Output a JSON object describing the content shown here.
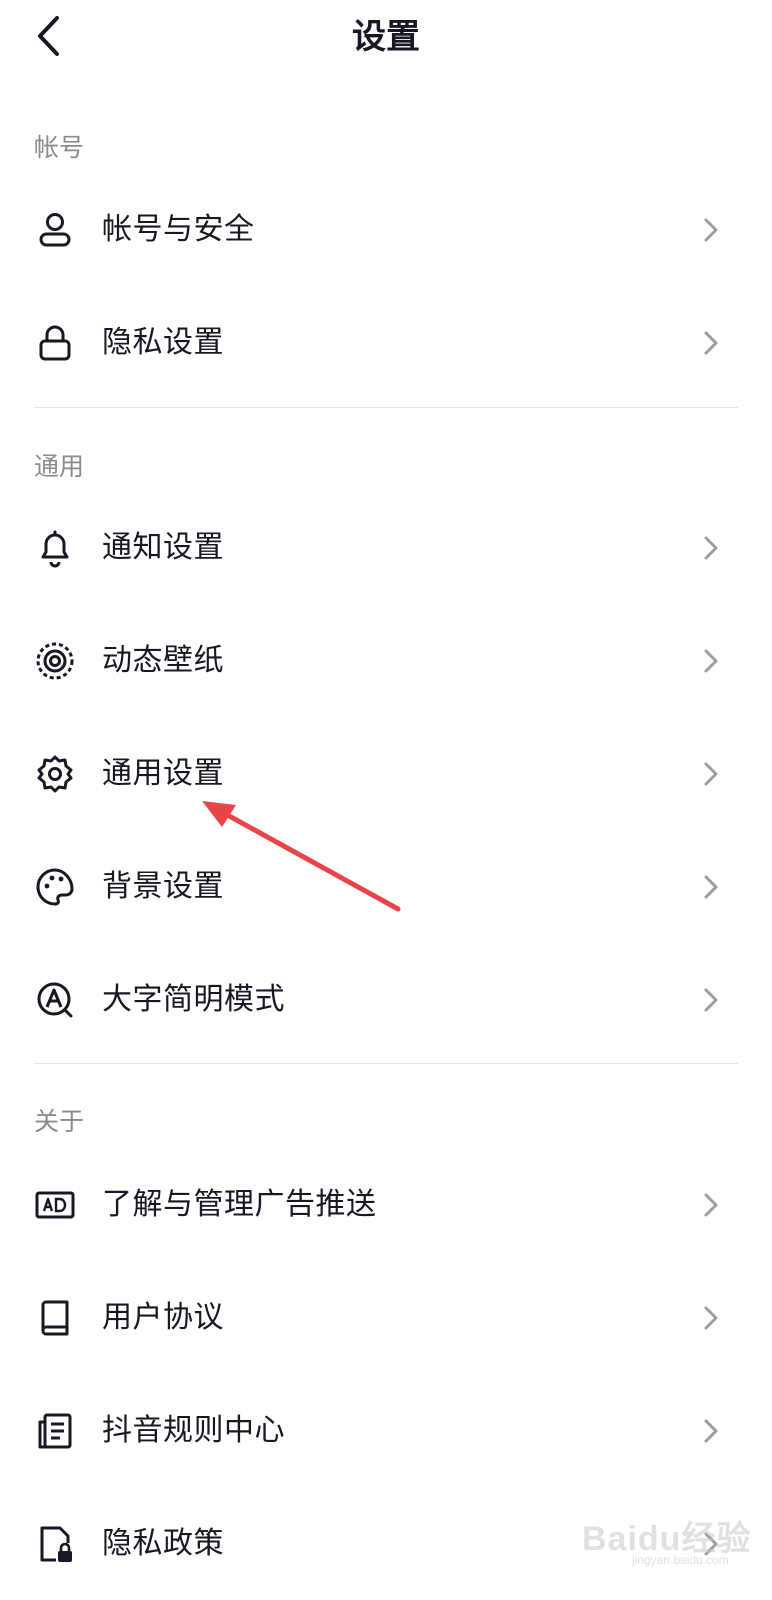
{
  "header": {
    "title": "设置"
  },
  "sections": [
    {
      "title": "帐号"
    },
    {
      "title": "通用"
    },
    {
      "title": "关于"
    }
  ],
  "rows": [
    {
      "label": "帐号与安全",
      "icon": "user-icon"
    },
    {
      "label": "隐私设置",
      "icon": "lock-icon"
    },
    {
      "label": "通知设置",
      "icon": "bell-icon"
    },
    {
      "label": "动态壁纸",
      "icon": "dynamic-wallpaper-icon"
    },
    {
      "label": "通用设置",
      "icon": "gear-icon"
    },
    {
      "label": "背景设置",
      "icon": "palette-icon"
    },
    {
      "label": "大字简明模式",
      "icon": "large-font-icon"
    },
    {
      "label": "了解与管理广告推送",
      "icon": "ad-icon"
    },
    {
      "label": "用户协议",
      "icon": "book-icon"
    },
    {
      "label": "抖音规则中心",
      "icon": "document-icon"
    },
    {
      "label": "隐私政策",
      "icon": "privacy-policy-icon"
    }
  ],
  "watermark": {
    "main": "Baidu经验",
    "sub": "jingyan.baidu.com"
  },
  "colors": {
    "annotation_arrow": "#e8454a",
    "text": "#161823",
    "section": "#8a8b91"
  }
}
